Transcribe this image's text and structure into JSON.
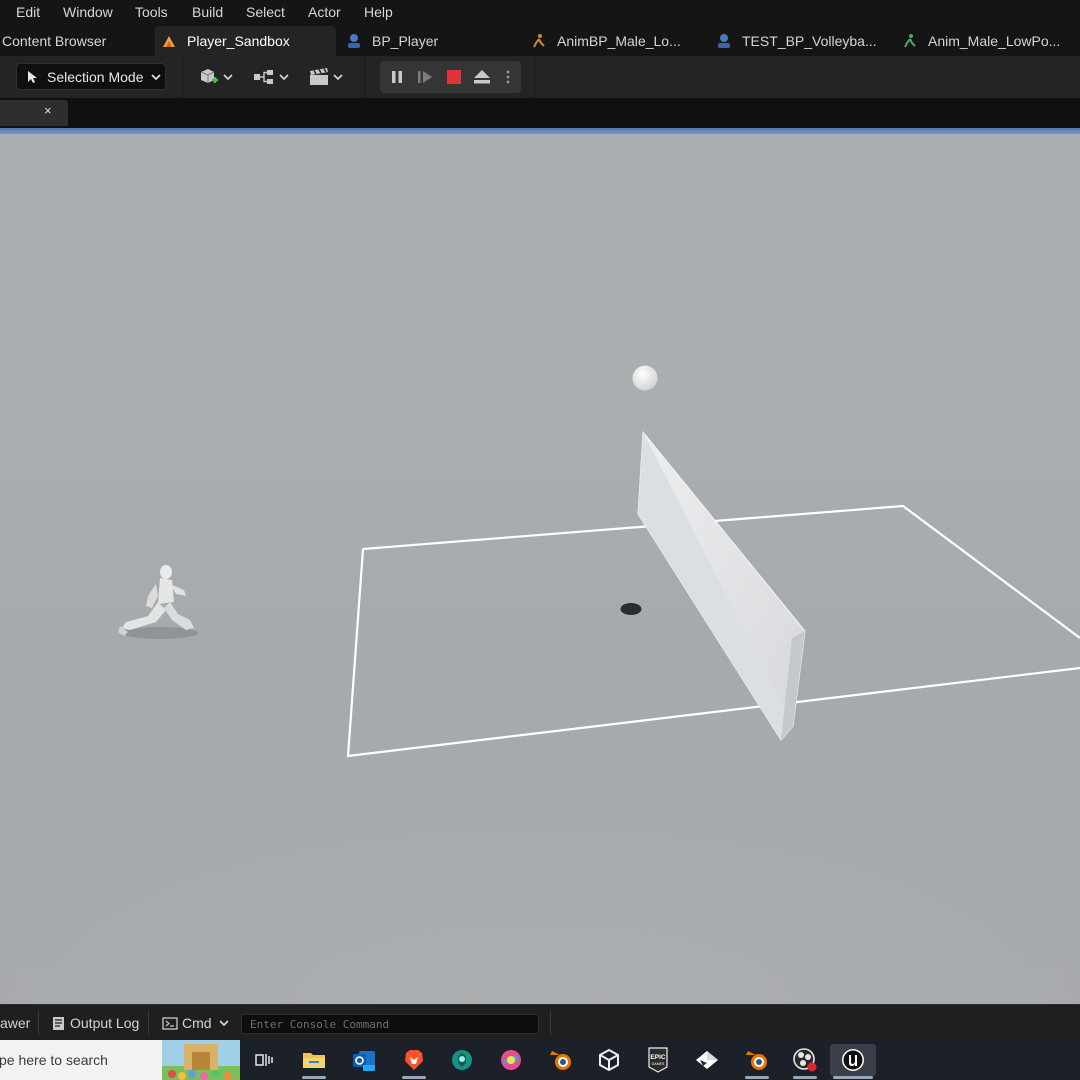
{
  "menu": [
    "Edit",
    "Window",
    "Tools",
    "Build",
    "Select",
    "Actor",
    "Help"
  ],
  "tabs": {
    "content_browser": "Content Browser",
    "player_sandbox": "Player_Sandbox",
    "bp_player": "BP_Player",
    "anim_bp": "AnimBP_Male_Lo...",
    "test_bp": "TEST_BP_Volleyba...",
    "anim_male": "Anim_Male_LowPo..."
  },
  "toolbar": {
    "selection_mode": "Selection Mode"
  },
  "viewport_tab": {
    "close": "×"
  },
  "statusbar": {
    "drawer": "awer",
    "output_log": "Output Log",
    "cmd": "Cmd",
    "console_placeholder": "Enter Console Command"
  },
  "taskbar": {
    "search": "ype here to search",
    "apps": [
      "task-view",
      "file-explorer",
      "outlook",
      "brave",
      "gitkraken",
      "krita",
      "blender",
      "unity",
      "epic-games",
      "inkscape",
      "blender-2",
      "obs",
      "unreal-engine"
    ]
  },
  "colors": {
    "accent_orange": "#f0a33a",
    "stop_red": "#e0343a",
    "viewport_blue": "#4d79b6",
    "court_line": "#ffffff"
  }
}
